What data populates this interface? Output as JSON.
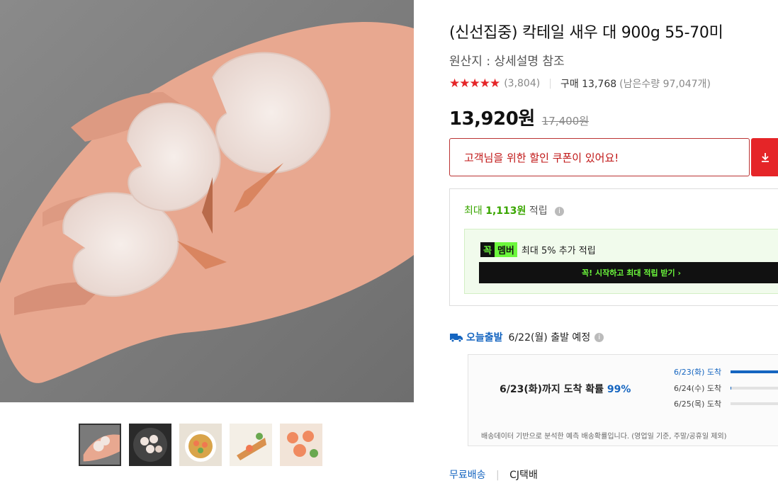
{
  "product": {
    "title": "(신선집중) 칵테일 새우 대 900g 55-70미",
    "origin": "원산지 : 상세설명 참조",
    "rating_stars": "★★★★★",
    "rating_count": "(3,804)",
    "purchase": "구매 13,768",
    "stock": "(남은수량 97,047개)",
    "price": "13,920원",
    "original_price": "17,400원"
  },
  "coupon": {
    "text": "고객님을 위한 할인 쿠폰이 있어요!",
    "button_icon": "download-icon"
  },
  "rewards": {
    "prefix": "최대",
    "amount": "1,113원",
    "suffix": "적립",
    "member_badge_a": "꼭",
    "member_badge_b": "멤버",
    "member_text": "최대 5% 추가 적립",
    "member_button": "꼭! 시작하고 최대 적립 받기 ›"
  },
  "shipping": {
    "label": "오늘출발",
    "date": "6/22(월) 출발 예정",
    "arrival_main": "6/23(화)까지 도착 확률",
    "arrival_prob": "99%",
    "rows": [
      {
        "label": "6/23(화) 도착",
        "value": 0.99
      },
      {
        "label": "6/24(수) 도착",
        "value": 0.01
      },
      {
        "label": "6/25(목) 도착",
        "value": 0.0
      }
    ],
    "note": "배송데이터 기반으로 분석한 예측 배송확률입니다. (영업일 기준, 주말/공휴일 제외)",
    "free_label": "무료배송",
    "carrier": "CJ택배"
  },
  "colors": {
    "accent_red": "#e52528",
    "accent_blue": "#1565c0",
    "accent_green": "#3aa600",
    "member_green": "#6cf73c"
  }
}
